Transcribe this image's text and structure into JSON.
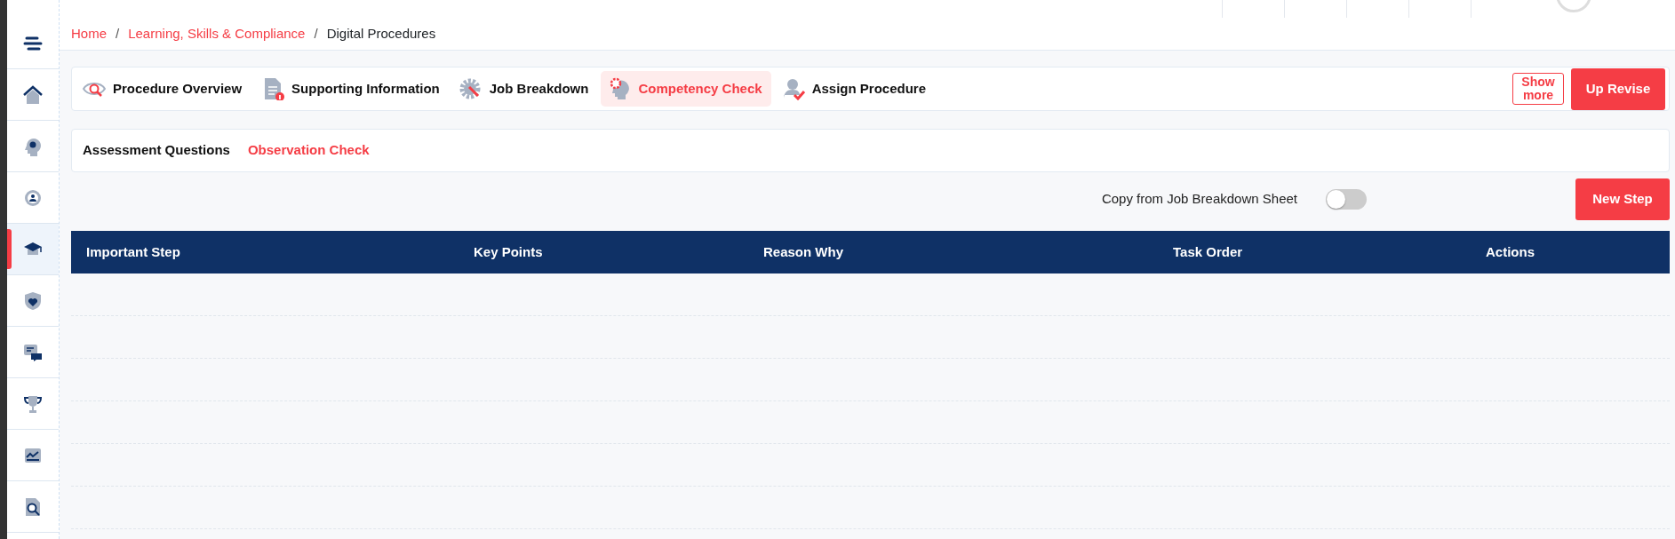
{
  "sidebar": {
    "items": [
      {
        "kind": "menu",
        "selected": false
      },
      {
        "kind": "home",
        "selected": false
      },
      {
        "kind": "head-gear",
        "selected": false
      },
      {
        "kind": "person-gear",
        "selected": false
      },
      {
        "kind": "cap",
        "selected": true
      },
      {
        "kind": "shield",
        "selected": false
      },
      {
        "kind": "chat",
        "selected": false
      },
      {
        "kind": "trophy",
        "selected": false
      },
      {
        "kind": "chart",
        "selected": false
      },
      {
        "kind": "doc-search",
        "selected": false
      }
    ]
  },
  "breadcrumbs": [
    {
      "label": "Home",
      "kind": "link"
    },
    {
      "label": "/",
      "kind": "separator"
    },
    {
      "label": "Learning, Skills & Compliance",
      "kind": "link"
    },
    {
      "label": "/",
      "kind": "separator"
    },
    {
      "label": "Digital Procedures",
      "kind": "current"
    }
  ],
  "tabs": [
    {
      "label": "Procedure Overview",
      "kind": "eye",
      "selected": false
    },
    {
      "label": "Supporting Information",
      "kind": "doc-info",
      "selected": false
    },
    {
      "label": "Job Breakdown",
      "kind": "gear-wrench",
      "selected": false
    },
    {
      "label": "Competency Check",
      "kind": "head-gear",
      "selected": true
    },
    {
      "label": "Assign Procedure",
      "kind": "person-check",
      "selected": false
    }
  ],
  "show_more_button": "Show more",
  "up_revise_button": "Up Revise",
  "subtabs": [
    {
      "label": "Assessment Questions",
      "selected": false
    },
    {
      "label": "Observation Check",
      "selected": true
    }
  ],
  "copy_toggle": {
    "label": "Copy from Job Breakdown Sheet",
    "on": false
  },
  "new_step_button": "New Step",
  "table": {
    "columns": [
      "Important Step",
      "Key Points",
      "Reason Why",
      "Task Order",
      "Actions"
    ]
  }
}
